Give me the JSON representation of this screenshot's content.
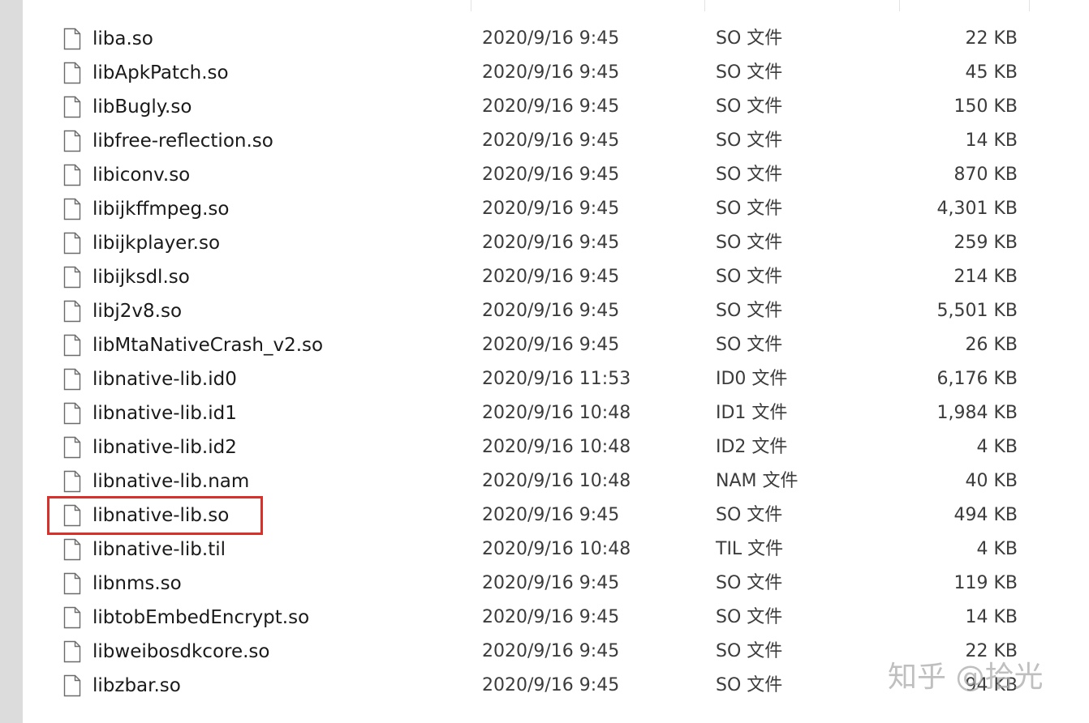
{
  "files": [
    {
      "name": "liba.so",
      "date": "2020/9/16 9:45",
      "type": "SO 文件",
      "size": "22 KB"
    },
    {
      "name": "libApkPatch.so",
      "date": "2020/9/16 9:45",
      "type": "SO 文件",
      "size": "45 KB"
    },
    {
      "name": "libBugly.so",
      "date": "2020/9/16 9:45",
      "type": "SO 文件",
      "size": "150 KB"
    },
    {
      "name": "libfree-reflection.so",
      "date": "2020/9/16 9:45",
      "type": "SO 文件",
      "size": "14 KB"
    },
    {
      "name": "libiconv.so",
      "date": "2020/9/16 9:45",
      "type": "SO 文件",
      "size": "870 KB"
    },
    {
      "name": "libijkffmpeg.so",
      "date": "2020/9/16 9:45",
      "type": "SO 文件",
      "size": "4,301 KB"
    },
    {
      "name": "libijkplayer.so",
      "date": "2020/9/16 9:45",
      "type": "SO 文件",
      "size": "259 KB"
    },
    {
      "name": "libijksdl.so",
      "date": "2020/9/16 9:45",
      "type": "SO 文件",
      "size": "214 KB"
    },
    {
      "name": "libj2v8.so",
      "date": "2020/9/16 9:45",
      "type": "SO 文件",
      "size": "5,501 KB"
    },
    {
      "name": "libMtaNativeCrash_v2.so",
      "date": "2020/9/16 9:45",
      "type": "SO 文件",
      "size": "26 KB"
    },
    {
      "name": "libnative-lib.id0",
      "date": "2020/9/16 11:53",
      "type": "ID0 文件",
      "size": "6,176 KB"
    },
    {
      "name": "libnative-lib.id1",
      "date": "2020/9/16 10:48",
      "type": "ID1 文件",
      "size": "1,984 KB"
    },
    {
      "name": "libnative-lib.id2",
      "date": "2020/9/16 10:48",
      "type": "ID2 文件",
      "size": "4 KB"
    },
    {
      "name": "libnative-lib.nam",
      "date": "2020/9/16 10:48",
      "type": "NAM 文件",
      "size": "40 KB"
    },
    {
      "name": "libnative-lib.so",
      "date": "2020/9/16 9:45",
      "type": "SO 文件",
      "size": "494 KB"
    },
    {
      "name": "libnative-lib.til",
      "date": "2020/9/16 10:48",
      "type": "TIL 文件",
      "size": "4 KB"
    },
    {
      "name": "libnms.so",
      "date": "2020/9/16 9:45",
      "type": "SO 文件",
      "size": "119 KB"
    },
    {
      "name": "libtobEmbedEncrypt.so",
      "date": "2020/9/16 9:45",
      "type": "SO 文件",
      "size": "14 KB"
    },
    {
      "name": "libweibosdkcore.so",
      "date": "2020/9/16 9:45",
      "type": "SO 文件",
      "size": "22 KB"
    },
    {
      "name": "libzbar.so",
      "date": "2020/9/16 9:45",
      "type": "SO 文件",
      "size": "94 KB"
    }
  ],
  "highlighted_file": "libnative-lib.so",
  "watermark": "知乎 @拾光",
  "icon": "file-icon",
  "colors": {
    "highlight_border": "#d9302b",
    "text": "#1a1a1a",
    "secondary_text": "#3c3c3c",
    "sidebar_strip": "#dcdcdc"
  }
}
